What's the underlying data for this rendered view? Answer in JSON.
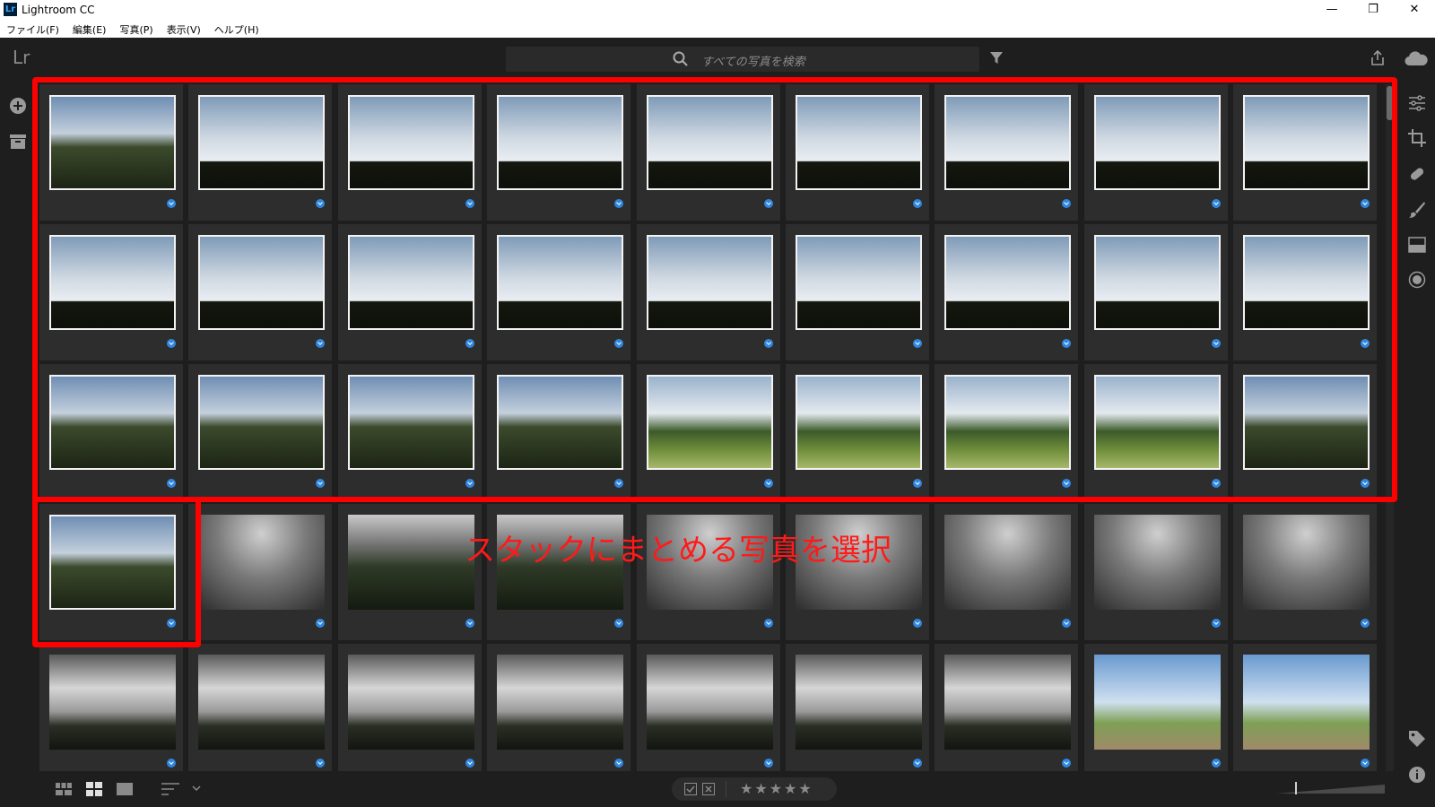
{
  "window": {
    "title": "Lightroom CC",
    "app_icon": "Lr",
    "minimize": "—",
    "maximize": "❐",
    "close": "✕"
  },
  "menu": [
    "ファイル(F)",
    "編集(E)",
    "写真(P)",
    "表示(V)",
    "ヘルプ(H)"
  ],
  "toolbar": {
    "logo": "Lr",
    "search_placeholder": "すべての写真を検索"
  },
  "bottom": {
    "stars": "★★★★★"
  },
  "annotation": {
    "text": "スタックにまとめる写真を選択",
    "color": "#ff0000"
  },
  "accent_color": "#2f86e0",
  "grid": {
    "rows": [
      {
        "kind": [
          "forest",
          "sky",
          "sky",
          "sky",
          "sky",
          "sky",
          "sky",
          "sky",
          "sky"
        ],
        "selected": [
          true,
          true,
          true,
          true,
          true,
          true,
          true,
          true,
          true
        ]
      },
      {
        "kind": [
          "sky",
          "sky",
          "sky",
          "sky",
          "sky",
          "sky",
          "sky",
          "sky",
          "sky"
        ],
        "selected": [
          true,
          true,
          true,
          true,
          true,
          true,
          true,
          true,
          true
        ]
      },
      {
        "kind": [
          "forest",
          "forest",
          "forest",
          "forest",
          "grass",
          "grass",
          "grass",
          "grass",
          "forest"
        ],
        "selected": [
          true,
          true,
          true,
          true,
          true,
          true,
          true,
          true,
          true
        ]
      },
      {
        "kind": [
          "forest",
          "fog",
          "fogwild",
          "fogwild",
          "fog",
          "fog",
          "fog",
          "fog",
          "fog"
        ],
        "selected": [
          true,
          false,
          false,
          false,
          false,
          false,
          false,
          false,
          false
        ]
      },
      {
        "kind": [
          "cloudy",
          "cloudy",
          "cloudy",
          "cloudy",
          "cloudy",
          "cloudy",
          "cloudy",
          "sign",
          "sign"
        ],
        "selected": [
          false,
          false,
          false,
          false,
          false,
          false,
          false,
          false,
          false
        ]
      }
    ]
  }
}
